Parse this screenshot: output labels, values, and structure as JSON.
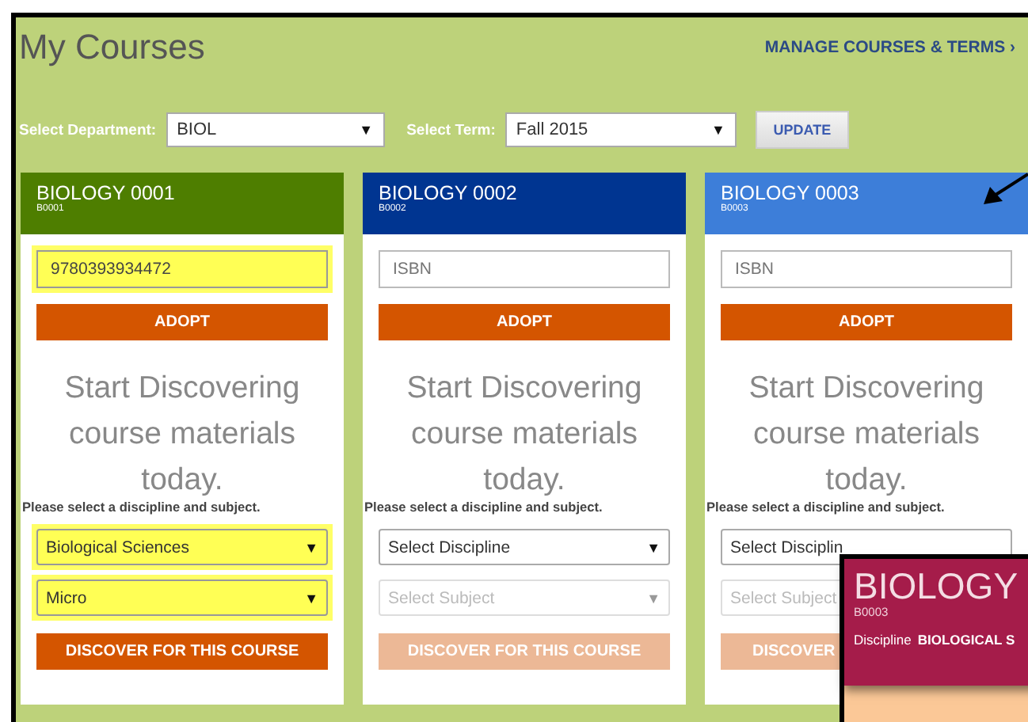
{
  "title": "My Courses",
  "manage_link": "MANAGE COURSES & TERMS ›",
  "filters": [
    {
      "label": "Select Department:",
      "value": "BIOL",
      "caret": "▼"
    },
    {
      "label": "Select Term:",
      "value": "Fall 2015",
      "caret": "▼"
    }
  ],
  "update_button": "UPDATE",
  "courses": [
    {
      "title": "BIOLOGY 0001",
      "code": "B0001",
      "color": "#4e7e00",
      "isbn": {
        "value": "9780393934472",
        "highlighted": true
      },
      "adopt": "ADOPT",
      "heading": "Start Discovering course materials today.",
      "prompt": "Please select a discipline and subject.",
      "discipline": {
        "value": "Biological Sciences",
        "highlighted": true,
        "disabled": false,
        "caret": "▼"
      },
      "subject": {
        "value": "Micro",
        "highlighted": true,
        "disabled": false,
        "caret": "▼"
      },
      "discover": {
        "label": "DISCOVER FOR THIS COURSE",
        "disabled": false
      }
    },
    {
      "title": "BIOLOGY 0002",
      "code": "B0002",
      "color": "#003591",
      "isbn": {
        "placeholder": "ISBN",
        "highlighted": false
      },
      "adopt": "ADOPT",
      "heading": "Start Discovering course materials today.",
      "prompt": "Please select a discipline and subject.",
      "discipline": {
        "value": "Select Discipline",
        "highlighted": false,
        "disabled": false,
        "caret": "▼"
      },
      "subject": {
        "value": "Select Subject",
        "highlighted": false,
        "disabled": true,
        "caret": "▼"
      },
      "discover": {
        "label": "DISCOVER FOR THIS COURSE",
        "disabled": true
      }
    },
    {
      "title": "BIOLOGY 0003",
      "code": "B0003",
      "color": "#3d7ed9",
      "isbn": {
        "placeholder": "ISBN",
        "highlighted": false
      },
      "adopt": "ADOPT",
      "heading": "Start Discovering course materials today.",
      "prompt": "Please select a discipline and subject.",
      "discipline": {
        "value": "Select Disciplin",
        "highlighted": false,
        "disabled": false
      },
      "subject": {
        "value": "Select Subject",
        "highlighted": false,
        "disabled": true
      },
      "discover": {
        "label": "DISCOVER",
        "disabled": true
      }
    }
  ],
  "popup": {
    "title": "BIOLOGY",
    "code": "B0003",
    "discipline_label": "Discipline",
    "discipline_value": "BIOLOGICAL S"
  }
}
